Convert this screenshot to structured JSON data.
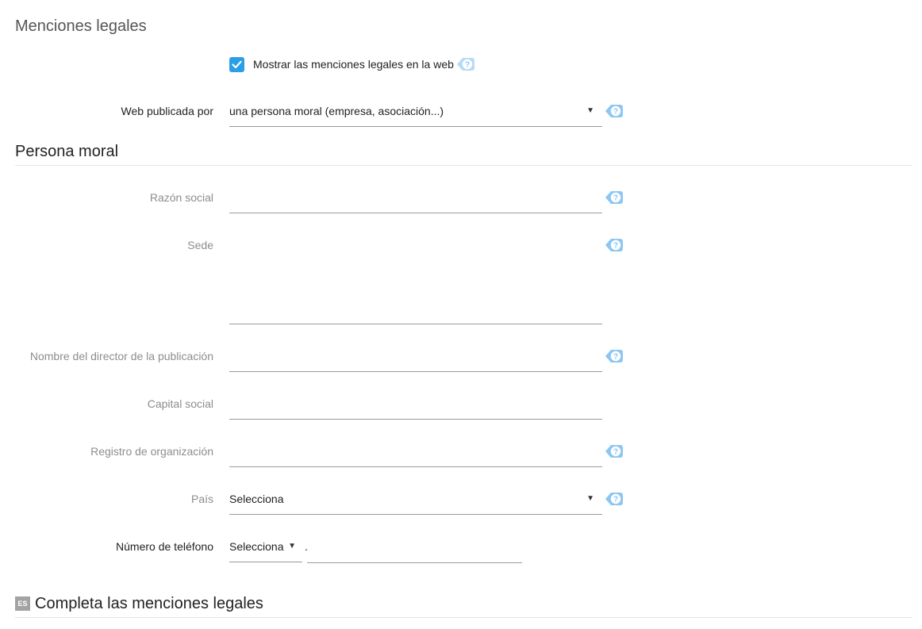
{
  "header": {
    "title": "Menciones legales"
  },
  "show_legal": {
    "checked": true,
    "label": "Mostrar las menciones legales en la web"
  },
  "published_by": {
    "label": "Web publicada por",
    "value": "una persona moral (empresa, asociación...)"
  },
  "moral_person": {
    "title": "Persona moral",
    "fields": {
      "razon_social": {
        "label": "Razón social",
        "value": ""
      },
      "sede": {
        "label": "Sede",
        "value": ""
      },
      "director": {
        "label": "Nombre del director de la publicación",
        "value": ""
      },
      "capital": {
        "label": "Capital social",
        "value": ""
      },
      "registro": {
        "label": "Registro de organización",
        "value": ""
      },
      "pais": {
        "label": "País",
        "value": "Selecciona"
      },
      "telefono": {
        "label": "Número de teléfono",
        "prefix": "Selecciona",
        "separator": ".",
        "number": ""
      }
    }
  },
  "complete": {
    "lang": "ES",
    "title": "Completa las menciones legales"
  },
  "colors": {
    "accent": "#2a9ee6",
    "help_icon": "#8cc7f2",
    "muted_label": "#8d8d8d"
  },
  "icons": {
    "help": "question-tag-icon",
    "check": "check-icon",
    "dropdown": "caret-down-icon"
  }
}
